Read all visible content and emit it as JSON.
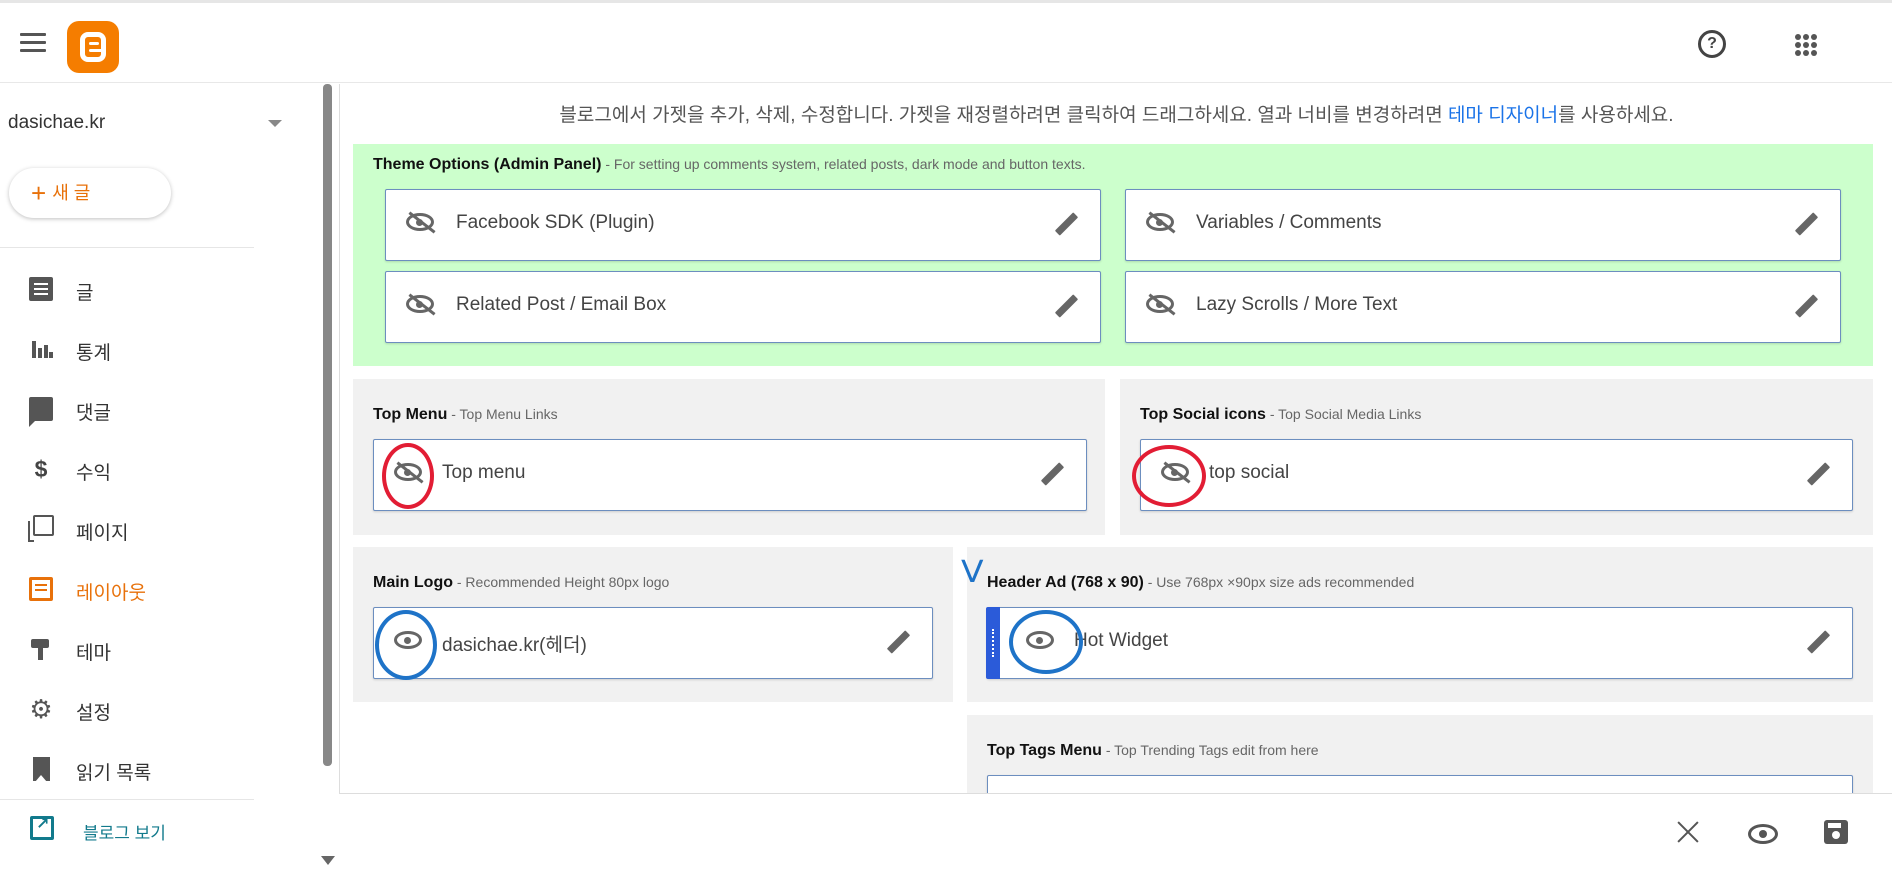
{
  "app": {
    "brand_color": "#f57d00"
  },
  "sidebar": {
    "blog_name": "dasichae.kr",
    "new_post_label": "새 글",
    "items": [
      {
        "label": "글",
        "icon": "posts-icon",
        "active": false
      },
      {
        "label": "통계",
        "icon": "stats-icon",
        "active": false
      },
      {
        "label": "댓글",
        "icon": "comments-icon",
        "active": false
      },
      {
        "label": "수익",
        "icon": "earnings-icon",
        "active": false
      },
      {
        "label": "페이지",
        "icon": "pages-icon",
        "active": false
      },
      {
        "label": "레이아웃",
        "icon": "layout-icon",
        "active": true
      },
      {
        "label": "테마",
        "icon": "theme-icon",
        "active": false
      },
      {
        "label": "설정",
        "icon": "settings-icon",
        "active": false
      },
      {
        "label": "읽기 목록",
        "icon": "reading-list-icon",
        "active": false
      }
    ],
    "view_blog_label": "블로그 보기"
  },
  "main": {
    "info_prefix": "블로그에서 가젯을 추가, 삭제, 수정합니다. 가젯을 재정렬하려면 클릭하여 드래그하세요. 열과 너비를 변경하려면 ",
    "info_link": "테마 디자이너",
    "info_suffix": "를 사용하세요.",
    "sections": {
      "theme_options": {
        "title": "Theme Options (Admin Panel)",
        "desc": " - For setting up comments system, related posts, dark mode and button texts.",
        "widgets": [
          {
            "label": "Facebook SDK (Plugin)",
            "visible": false
          },
          {
            "label": "Variables / Comments",
            "visible": false
          },
          {
            "label": "Related Post / Email Box",
            "visible": false
          },
          {
            "label": "Lazy Scrolls / More Text",
            "visible": false
          }
        ]
      },
      "top_menu": {
        "title": "Top Menu",
        "desc": " - Top Menu Links",
        "widgets": [
          {
            "label": "Top menu",
            "visible": false
          }
        ]
      },
      "top_social": {
        "title": "Top Social icons",
        "desc": " - Top Social Media Links",
        "widgets": [
          {
            "label": "top social",
            "visible": false
          }
        ]
      },
      "main_logo": {
        "title": "Main Logo",
        "desc": " - Recommended Height 80px logo",
        "widgets": [
          {
            "label": "dasichae.kr(헤더)",
            "visible": true
          }
        ]
      },
      "header_ad": {
        "title": "Header Ad (768 x 90)",
        "desc": " - Use 768px ×90px size ads recommended",
        "widgets": [
          {
            "label": "Hot Widget",
            "visible": true
          }
        ]
      },
      "top_tags": {
        "title": "Top Tags Menu",
        "desc": " - Top Trending Tags edit from here"
      }
    },
    "annotation_mark": "V"
  },
  "colors": {
    "accent": "#e8710a",
    "link": "#1a73e8",
    "highlight_green": "#ccffcc",
    "annotation_red": "#e21d34",
    "annotation_blue": "#1e73c8"
  }
}
